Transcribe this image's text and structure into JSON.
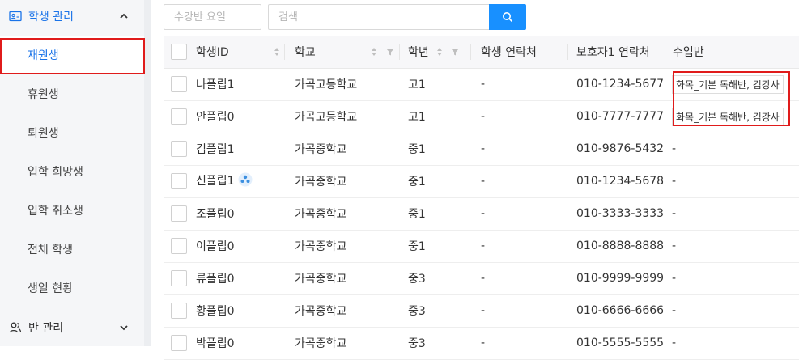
{
  "sidebar": {
    "group1": {
      "label": "학생 관리",
      "icon": "id-card-icon",
      "expanded": true
    },
    "items": [
      {
        "label": "재원생",
        "active": true
      },
      {
        "label": "휴원생",
        "active": false
      },
      {
        "label": "퇴원생",
        "active": false
      },
      {
        "label": "입학 희망생",
        "active": false
      },
      {
        "label": "입학 취소생",
        "active": false
      },
      {
        "label": "전체 학생",
        "active": false
      },
      {
        "label": "생일 현황",
        "active": false
      }
    ],
    "group2": {
      "label": "반 관리",
      "icon": "users-icon",
      "expanded": false
    }
  },
  "filters": {
    "weekday_placeholder": "수강반 요일",
    "search_placeholder": "검색",
    "search_icon": "search-icon"
  },
  "table": {
    "headers": {
      "id": "학생ID",
      "school": "학교",
      "grade": "학년",
      "phone": "학생 연락처",
      "guardian_phone": "보호자1 연락처",
      "class": "수업반"
    },
    "rows": [
      {
        "id": "나플립1",
        "school": "가곡고등학교",
        "grade": "고1",
        "phone": "-",
        "guardian_phone": "010-1234-5677",
        "class": "화목_기본 독해반, 김강사",
        "badge": false
      },
      {
        "id": "안플립0",
        "school": "가곡고등학교",
        "grade": "고1",
        "phone": "-",
        "guardian_phone": "010-7777-7777",
        "class": "화목_기본 독해반, 김강사",
        "badge": false
      },
      {
        "id": "김플립1",
        "school": "가곡중학교",
        "grade": "중1",
        "phone": "-",
        "guardian_phone": "010-9876-5432",
        "class": "-",
        "badge": false
      },
      {
        "id": "신플립1",
        "school": "가곡중학교",
        "grade": "중1",
        "phone": "-",
        "guardian_phone": "010-1234-5678",
        "class": "-",
        "badge": true
      },
      {
        "id": "조플립0",
        "school": "가곡중학교",
        "grade": "중1",
        "phone": "-",
        "guardian_phone": "010-3333-3333",
        "class": "-",
        "badge": false
      },
      {
        "id": "이플립0",
        "school": "가곡중학교",
        "grade": "중1",
        "phone": "-",
        "guardian_phone": "010-8888-8888",
        "class": "-",
        "badge": false
      },
      {
        "id": "류플립0",
        "school": "가곡중학교",
        "grade": "중3",
        "phone": "-",
        "guardian_phone": "010-9999-9999",
        "class": "-",
        "badge": false
      },
      {
        "id": "황플립0",
        "school": "가곡중학교",
        "grade": "중3",
        "phone": "-",
        "guardian_phone": "010-6666-6666",
        "class": "-",
        "badge": false
      },
      {
        "id": "박플립0",
        "school": "가곡중학교",
        "grade": "중3",
        "phone": "-",
        "guardian_phone": "010-5555-5555",
        "class": "-",
        "badge": false
      }
    ]
  },
  "colors": {
    "accent": "#1890ff",
    "active_text": "#1a73e8",
    "highlight": "#e01b1b",
    "badge": "#3b8fe0"
  }
}
